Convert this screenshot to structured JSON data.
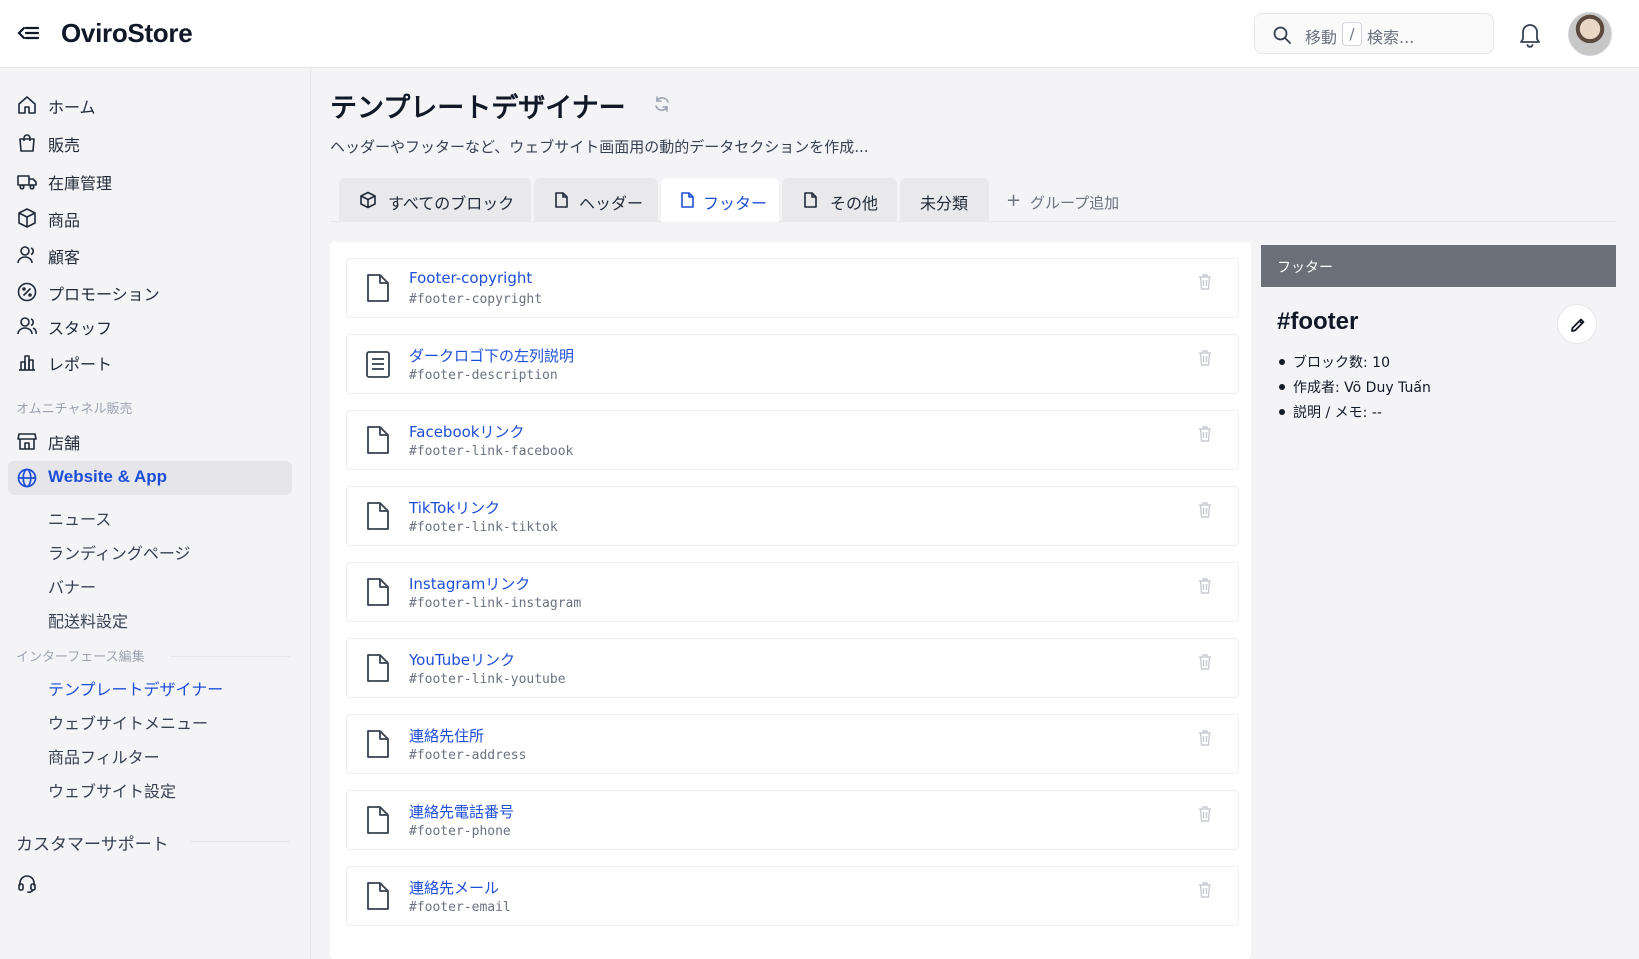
{
  "app": {
    "brand": "OviroStore"
  },
  "header": {
    "search_prefix": "移動",
    "search_key": "/",
    "search_suffix": "検索..."
  },
  "sidebar": {
    "items": [
      {
        "label": "ホーム",
        "icon": "home-icon"
      },
      {
        "label": "販売",
        "icon": "shopping-bag-icon"
      },
      {
        "label": "在庫管理",
        "icon": "truck-icon"
      },
      {
        "label": "商品",
        "icon": "box-icon"
      },
      {
        "label": "顧客",
        "icon": "user-icon"
      },
      {
        "label": "プロモーション",
        "icon": "percent-icon"
      },
      {
        "label": "スタッフ",
        "icon": "users-icon"
      },
      {
        "label": "レポート",
        "icon": "chart-icon"
      }
    ],
    "omni_section": "オムニチャネル販売",
    "store_label": "店舗",
    "website_label": "Website & App",
    "website_sub": [
      "ニュース",
      "ランディングページ",
      "バナー",
      "配送料設定"
    ],
    "interface_section": "インターフェース編集",
    "interface_sub": [
      "テンプレートデザイナー",
      "ウェブサイトメニュー",
      "商品フィルター",
      "ウェブサイト設定"
    ],
    "support_section": "カスタマーサポート"
  },
  "page": {
    "title": "テンプレートデザイナー",
    "description": "ヘッダーやフッターなど、ウェブサイト画面用の動的データセクションを作成..."
  },
  "tabs": [
    {
      "label": "すべてのブロック",
      "icon": "cube-icon"
    },
    {
      "label": "ヘッダー",
      "icon": "file-icon"
    },
    {
      "label": "フッター",
      "icon": "file-icon",
      "active": true
    },
    {
      "label": "その他",
      "icon": "file-icon"
    },
    {
      "label": "未分類"
    }
  ],
  "add_group_label": "グループ追加",
  "blocks": [
    {
      "name": "Footer-copyright",
      "code": "#footer-copyright",
      "icon": "file-icon"
    },
    {
      "name": "ダークロゴ下の左列説明",
      "code": "#footer-description",
      "icon": "text-file-icon"
    },
    {
      "name": "Facebookリンク",
      "code": "#footer-link-facebook",
      "icon": "file-icon"
    },
    {
      "name": "TikTokリンク",
      "code": "#footer-link-tiktok",
      "icon": "file-icon"
    },
    {
      "name": "Instagramリンク",
      "code": "#footer-link-instagram",
      "icon": "file-icon"
    },
    {
      "name": "YouTubeリンク",
      "code": "#footer-link-youtube",
      "icon": "file-icon"
    },
    {
      "name": "連絡先住所",
      "code": "#footer-address",
      "icon": "file-icon"
    },
    {
      "name": "連絡先電話番号",
      "code": "#footer-phone",
      "icon": "file-icon"
    },
    {
      "name": "連絡先メール",
      "code": "#footer-email",
      "icon": "file-icon"
    }
  ],
  "detail": {
    "header": "フッター",
    "title": "#footer",
    "items": [
      "ブロック数: 10",
      "作成者: Võ Duy Tuấn",
      "説明 / メモ: --"
    ]
  },
  "colors": {
    "accent": "#1d4ed8",
    "panel_header": "#6b7078",
    "background": "#f4f4f6"
  }
}
